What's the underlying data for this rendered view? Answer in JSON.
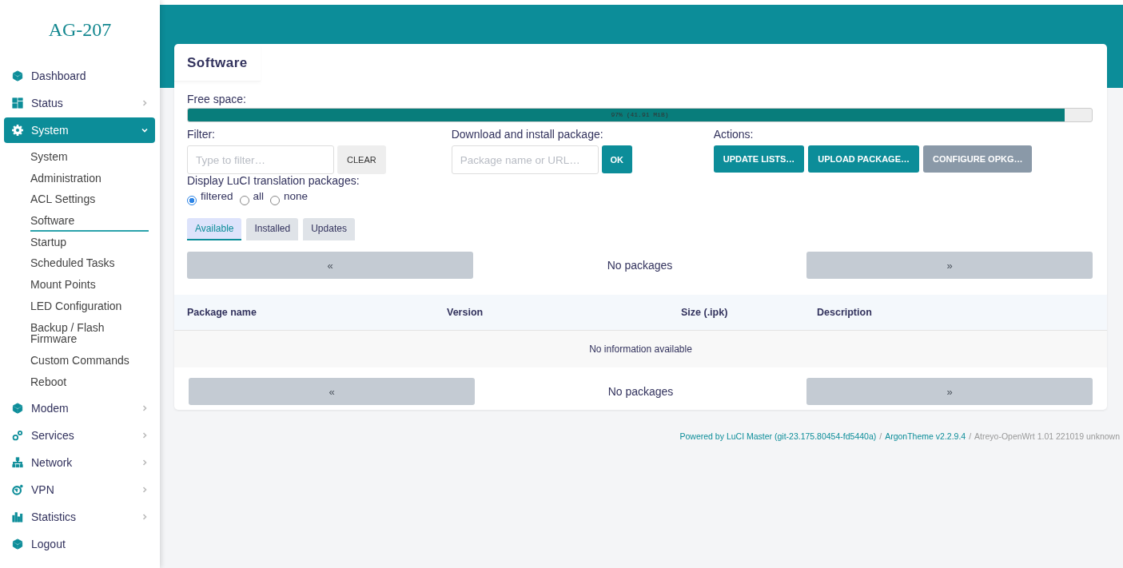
{
  "brand": "AG-207",
  "sidebar": {
    "items": [
      {
        "label": "Dashboard",
        "kind": "cube",
        "selected": false
      },
      {
        "label": "Status",
        "kind": "grid",
        "selected": false,
        "expanded": false
      },
      {
        "label": "System",
        "kind": "gear",
        "selected": true,
        "expanded": true,
        "children": [
          {
            "label": "System",
            "selected": false
          },
          {
            "label": "Administration",
            "selected": false
          },
          {
            "label": "ACL Settings",
            "selected": false
          },
          {
            "label": "Software",
            "selected": true
          },
          {
            "label": "Startup",
            "selected": false
          },
          {
            "label": "Scheduled Tasks",
            "selected": false
          },
          {
            "label": "Mount Points",
            "selected": false
          },
          {
            "label": "LED Configuration",
            "selected": false
          },
          {
            "label": "Backup / Flash Firmware",
            "selected": false
          },
          {
            "label": "Custom Commands",
            "selected": false
          },
          {
            "label": "Reboot",
            "selected": false
          }
        ]
      },
      {
        "label": "Modem",
        "kind": "cube",
        "selected": false,
        "expanded": false
      },
      {
        "label": "Services",
        "kind": "gears",
        "selected": false,
        "expanded": false
      },
      {
        "label": "Network",
        "kind": "network",
        "selected": false,
        "expanded": false
      },
      {
        "label": "VPN",
        "kind": "globe",
        "selected": false,
        "expanded": false
      },
      {
        "label": "Statistics",
        "kind": "chart",
        "selected": false,
        "expanded": false
      },
      {
        "label": "Logout",
        "kind": "cube",
        "selected": false
      }
    ]
  },
  "page": {
    "title": "Software",
    "free_space": {
      "label": "Free space:",
      "level": 0.97,
      "reading": "97% (41.91 MiB)"
    },
    "filter": {
      "label": "Filter:",
      "placeholder": "Type to filter…",
      "button": "CLEAR"
    },
    "download": {
      "label": "Download and install package:",
      "placeholder": "Package name or URL…",
      "button": "OK"
    },
    "actions": {
      "label": "Actions:",
      "buttons": [
        {
          "label": "UPDATE LISTS…",
          "kind": "primary"
        },
        {
          "label": "UPLOAD PACKAGE…",
          "kind": "primary"
        },
        {
          "label": "CONFIGURE OPKG…",
          "kind": "secondary"
        }
      ]
    },
    "translation": {
      "label": "Display LuCI translation packages:",
      "options": [
        {
          "label": "filtered",
          "selected": true
        },
        {
          "label": "all",
          "selected": false
        },
        {
          "label": "none",
          "selected": false
        }
      ]
    },
    "tabs": [
      {
        "label": "Available",
        "selected": true
      },
      {
        "label": "Installed",
        "selected": false
      },
      {
        "label": "Updates",
        "selected": false
      }
    ],
    "pager_top": {
      "prev": "«",
      "status": "No packages",
      "next": "»"
    },
    "table": {
      "columns": [
        "Package name",
        "Version",
        "Size (.ipk)",
        "Description"
      ],
      "empty": "No information available"
    },
    "pager_bottom": {
      "prev": "«",
      "status": "No packages",
      "next": "»"
    }
  },
  "footer": {
    "luci": "Powered by LuCI Master (git-23.175.80454-fd5440a)",
    "sep1": "/",
    "theme": "ArgonTheme v2.2.9.4",
    "sep2": "/",
    "firmware": "Atreyo-OpenWrt 1.01 221019 unknown"
  }
}
